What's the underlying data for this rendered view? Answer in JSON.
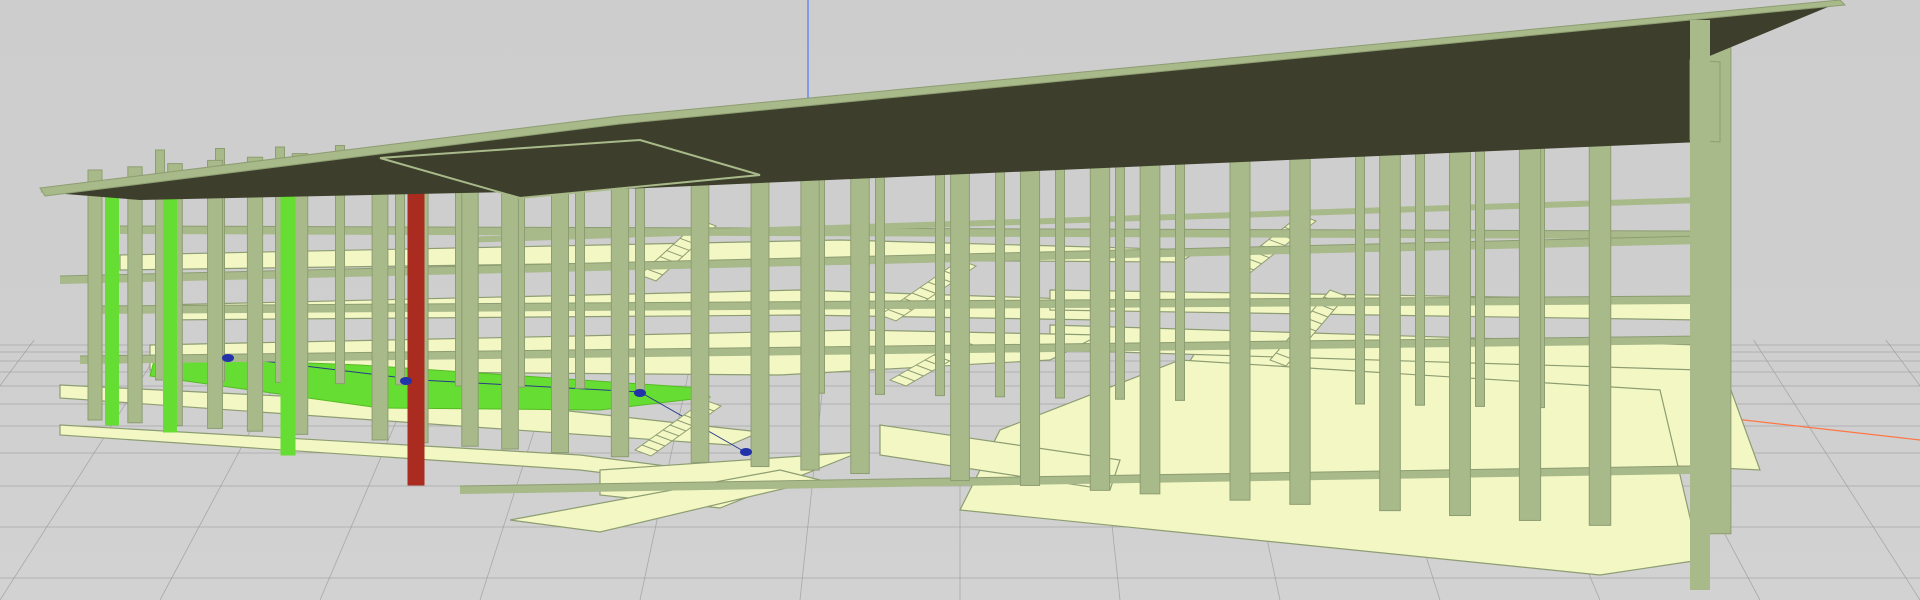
{
  "viewport": {
    "background_color": "#cfcfcf",
    "ground_grid_color": "#9a9a9a",
    "frame_color": "#a8b98a",
    "frame_edge_color": "#8d9d72",
    "slab_underside_color": "#3d3f2c",
    "floor_slab_color": "#f3f7c4",
    "selected_elements_color": "#66dd33",
    "highlighted_column_color": "#aa2b20",
    "marker_color": "#2233aa",
    "axis_y_color": "#5577ff",
    "axis_x_color": "#ff7744"
  },
  "model": {
    "element_types": [
      "column",
      "beam",
      "floor-slab",
      "roof-slab",
      "stair"
    ],
    "floor_levels": 4,
    "selected_columns": 3,
    "highlighted_columns": 1
  }
}
